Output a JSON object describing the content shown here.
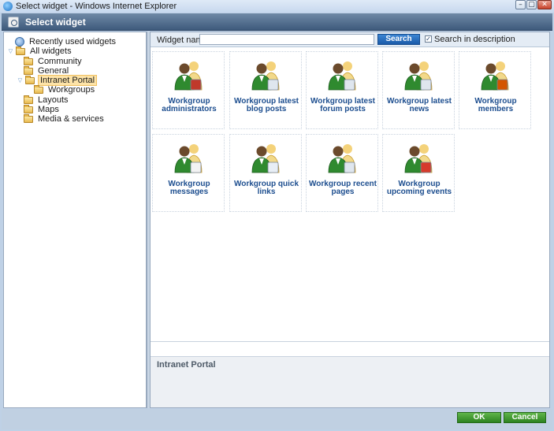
{
  "window": {
    "title": "Select widget - Windows Internet Explorer",
    "min_glyph": "–",
    "max_glyph": "▢",
    "close_glyph": "✕"
  },
  "dialog": {
    "title": "Select widget"
  },
  "tree": {
    "items": [
      {
        "label": "Recently used widgets",
        "icon": "recent-widgets-icon",
        "level": 0,
        "toggle": ""
      },
      {
        "label": "All widgets",
        "icon": "folder-icon",
        "level": 0,
        "toggle": "▽"
      },
      {
        "label": "Community",
        "icon": "folder-icon",
        "level": 1,
        "toggle": ""
      },
      {
        "label": "General",
        "icon": "folder-icon",
        "level": 1,
        "toggle": ""
      },
      {
        "label": "Intranet Portal",
        "icon": "folder-icon",
        "level": 1,
        "toggle": "▽",
        "selected": true
      },
      {
        "label": "Workgroups",
        "icon": "folder-icon",
        "level": 2,
        "toggle": ""
      },
      {
        "label": "Layouts",
        "icon": "folder-icon",
        "level": 1,
        "toggle": ""
      },
      {
        "label": "Maps",
        "icon": "folder-icon",
        "level": 1,
        "toggle": ""
      },
      {
        "label": "Media & services",
        "icon": "folder-icon",
        "level": 1,
        "toggle": ""
      }
    ]
  },
  "search": {
    "label": "Widget name:",
    "value": "",
    "placeholder": "",
    "button_label": "Search",
    "description_checked": true,
    "description_check_glyph": "✓",
    "description_label": "Search in description"
  },
  "widgets": [
    {
      "label": "Workgroup administrators",
      "icon": "workgroup-administrators-icon",
      "badge": "#c0392b"
    },
    {
      "label": "Workgroup latest blog posts",
      "icon": "workgroup-blog-posts-icon",
      "badge": "#dfe6ee"
    },
    {
      "label": "Workgroup latest forum posts",
      "icon": "workgroup-forum-posts-icon",
      "badge": "#dfe6ee"
    },
    {
      "label": "Workgroup latest news",
      "icon": "workgroup-news-icon",
      "badge": "#dfe6ee"
    },
    {
      "label": "Workgroup members",
      "icon": "workgroup-members-icon",
      "badge": "#d35400"
    },
    {
      "label": "Workgroup messages",
      "icon": "workgroup-messages-icon",
      "badge": "#f3f3f3"
    },
    {
      "label": "Workgroup quick links",
      "icon": "workgroup-quick-links-icon",
      "badge": "#e8eef5"
    },
    {
      "label": "Workgroup recent pages",
      "icon": "workgroup-recent-pages-icon",
      "badge": "#dfe6ee"
    },
    {
      "label": "Workgroup upcoming events",
      "icon": "workgroup-upcoming-events-icon",
      "badge": "#d63b2c"
    }
  ],
  "description": {
    "title": "Intranet Portal"
  },
  "footer": {
    "ok_label": "OK",
    "cancel_label": "Cancel"
  },
  "colors": {
    "accent_blue": "#1a5aa8",
    "ok_green": "#2e8320",
    "widget_label": "#1d4e8f",
    "header": "#3e5a7c"
  }
}
